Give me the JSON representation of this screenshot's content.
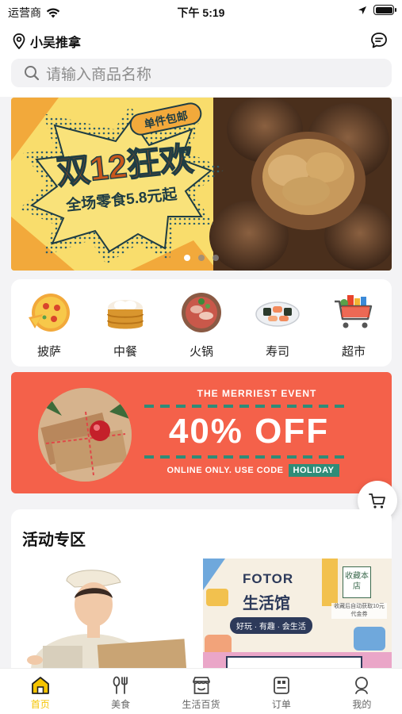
{
  "status_bar": {
    "carrier": "运营商",
    "time": "下午 5:19"
  },
  "header": {
    "location": "小吴推拿"
  },
  "search": {
    "placeholder": "请输入商品名称"
  },
  "banner": {
    "tag": "单件包邮",
    "title": "双12狂欢",
    "subtitle": "全场零食5.8元起",
    "active_slide": 1,
    "slide_count": 3
  },
  "categories": [
    {
      "label": "披萨",
      "icon": "pizza-icon"
    },
    {
      "label": "中餐",
      "icon": "steamer-icon"
    },
    {
      "label": "火锅",
      "icon": "hotpot-icon"
    },
    {
      "label": "寿司",
      "icon": "sushi-icon"
    },
    {
      "label": "超市",
      "icon": "supermarket-cart-icon"
    }
  ],
  "promo": {
    "subtitle": "The merriest event",
    "headline": "40% OFF",
    "note": "Online only. Use code",
    "code": "HOLIDAY"
  },
  "activity": {
    "title": "活动专区",
    "card_right": {
      "brand": "FOTOR",
      "name": "生活馆",
      "tags": "好玩 · 有趣 · 会生活",
      "stamp": "收藏本店",
      "note": "收藏后自动获取10元代金券"
    }
  },
  "tabbar": {
    "active": 0,
    "items": [
      {
        "label": "首页",
        "icon": "home-icon"
      },
      {
        "label": "美食",
        "icon": "food-icon"
      },
      {
        "label": "生活百货",
        "icon": "store-icon"
      },
      {
        "label": "订单",
        "icon": "order-icon"
      },
      {
        "label": "我的",
        "icon": "profile-icon"
      }
    ]
  },
  "colors": {
    "accent": "#f5c400",
    "promo_bg": "#f4614a",
    "promo_code_bg": "#2f8c78"
  }
}
